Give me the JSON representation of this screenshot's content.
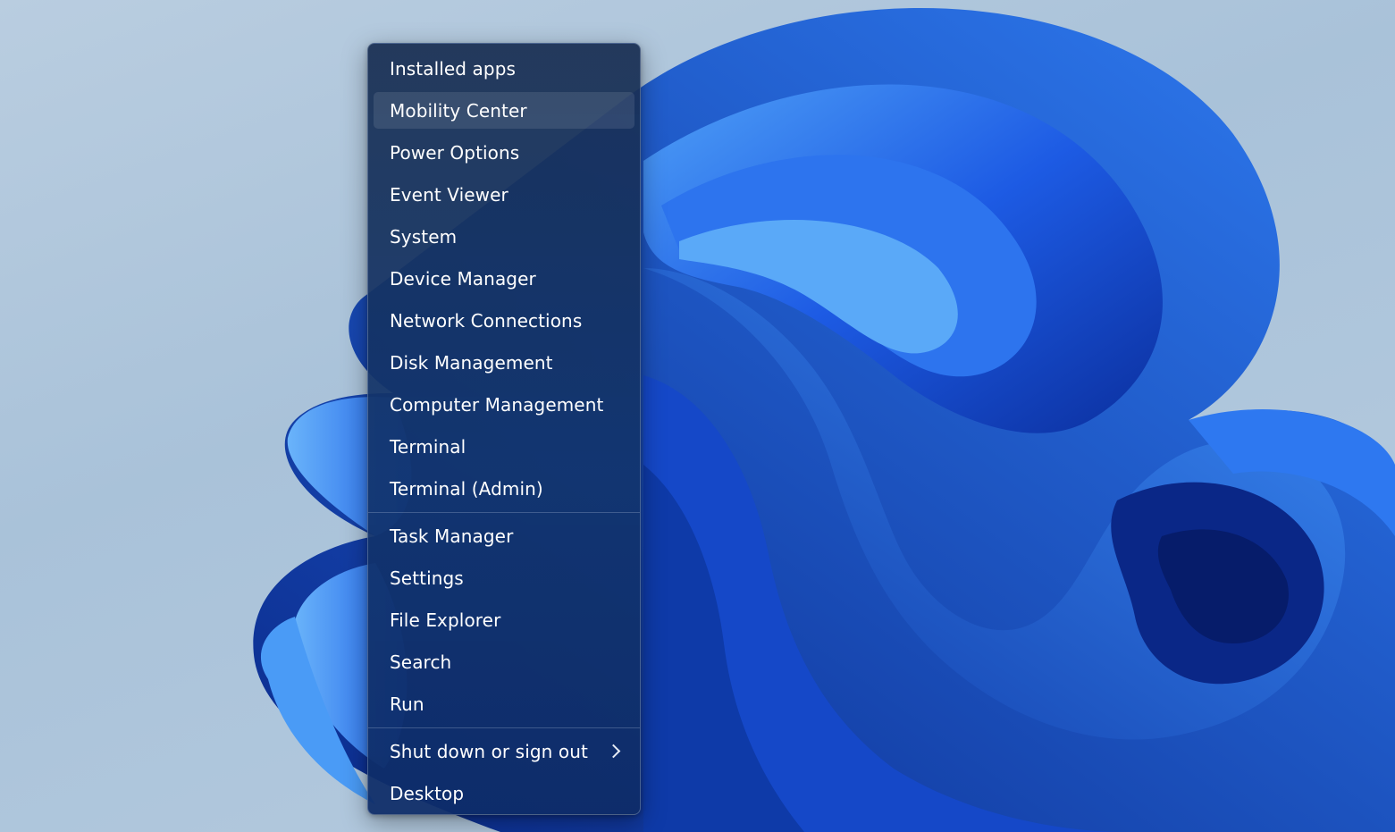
{
  "menu": {
    "groups": [
      {
        "items": [
          {
            "label": "Installed apps"
          },
          {
            "label": "Mobility Center",
            "highlighted": true
          },
          {
            "label": "Power Options"
          },
          {
            "label": "Event Viewer"
          },
          {
            "label": "System"
          },
          {
            "label": "Device Manager"
          },
          {
            "label": "Network Connections"
          },
          {
            "label": "Disk Management"
          },
          {
            "label": "Computer Management"
          },
          {
            "label": "Terminal"
          },
          {
            "label": "Terminal (Admin)"
          }
        ]
      },
      {
        "items": [
          {
            "label": "Task Manager"
          },
          {
            "label": "Settings"
          },
          {
            "label": "File Explorer"
          },
          {
            "label": "Search"
          },
          {
            "label": "Run"
          }
        ]
      },
      {
        "items": [
          {
            "label": "Shut down or sign out",
            "submenu": true,
            "icon": "chevron-right-icon"
          },
          {
            "label": "Desktop"
          }
        ]
      }
    ]
  },
  "colors": {
    "menu_text": "#ffffff",
    "menu_background": "#15346a",
    "wallpaper_sky": "#b3c8dd",
    "wallpaper_bloom": "#1c5ee6"
  }
}
